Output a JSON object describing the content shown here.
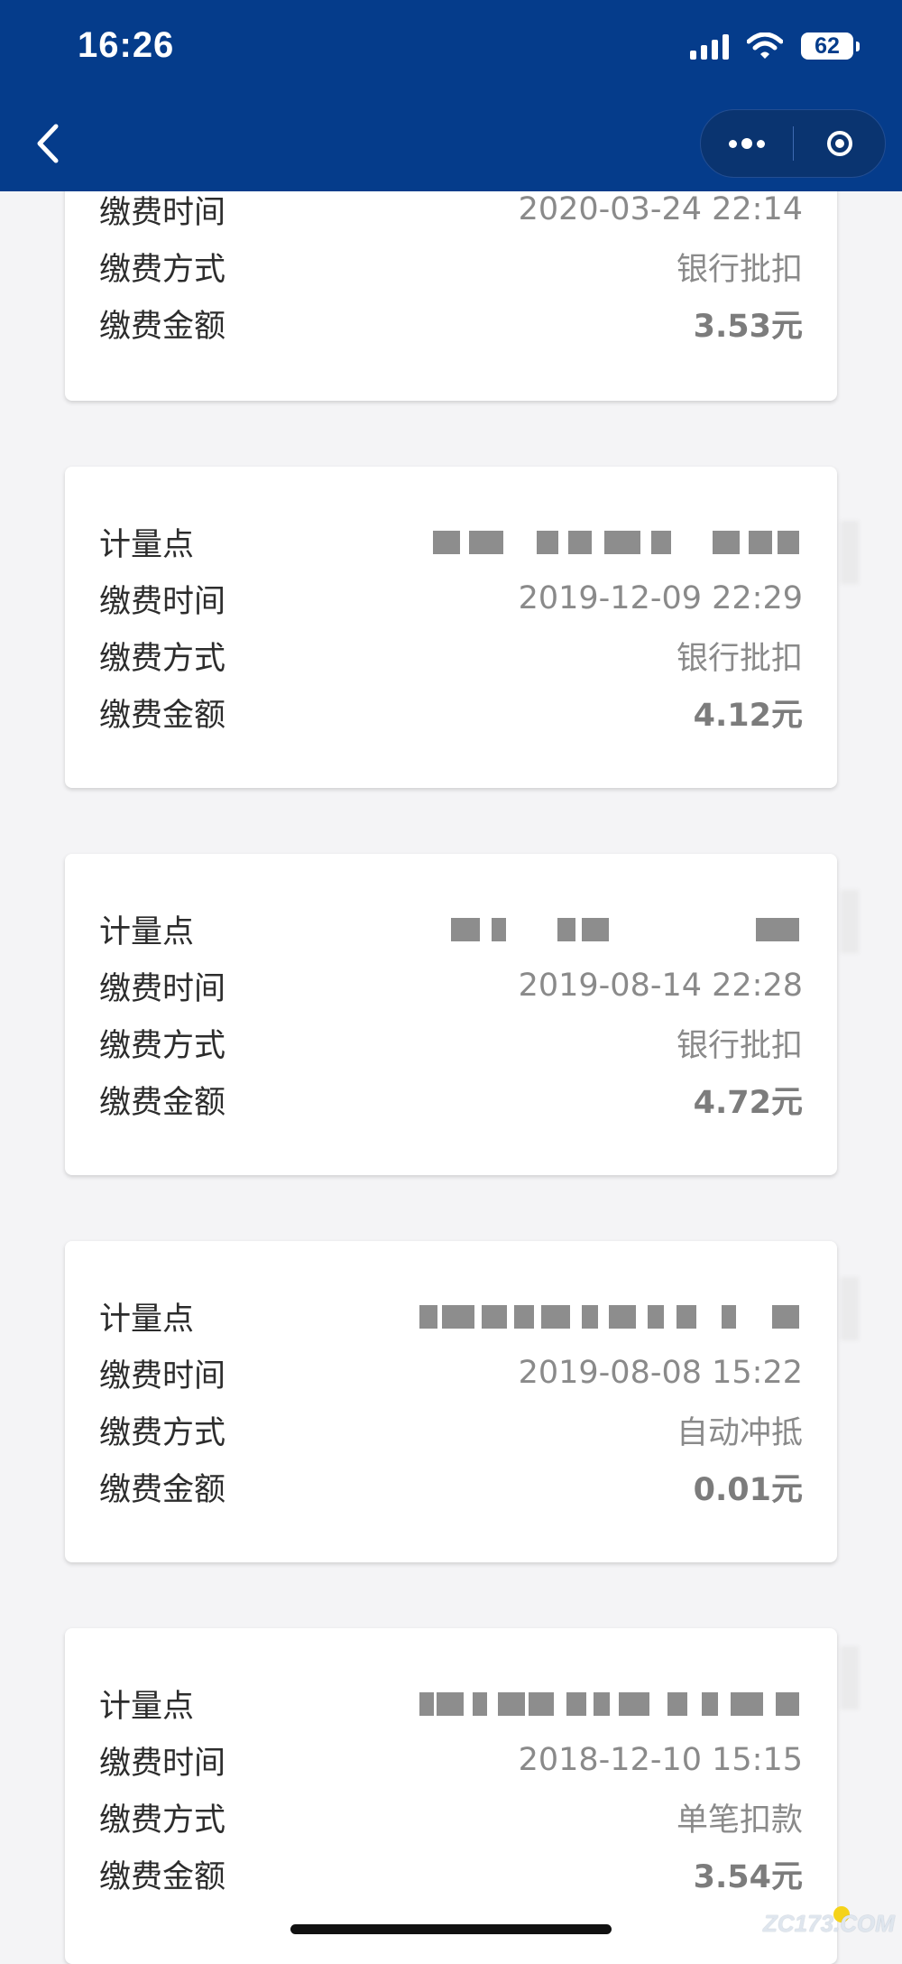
{
  "status_bar": {
    "time": "16:26",
    "battery": "62"
  },
  "field_labels": {
    "meter_point": "计量点",
    "pay_time": "缴费时间",
    "pay_method": "缴费方式",
    "pay_amount": "缴费金额"
  },
  "records": [
    {
      "pay_time": "2020-03-24 22:14",
      "pay_method": "银行批扣",
      "pay_amount": "3.53元"
    },
    {
      "pay_time": "2019-12-09 22:29",
      "pay_method": "银行批扣",
      "pay_amount": "4.12元"
    },
    {
      "pay_time": "2019-08-14 22:28",
      "pay_method": "银行批扣",
      "pay_amount": "4.72元"
    },
    {
      "pay_time": "2019-08-08 15:22",
      "pay_method": "自动冲抵",
      "pay_amount": "0.01元"
    },
    {
      "pay_time": "2018-12-10 15:15",
      "pay_method": "单笔扣款",
      "pay_amount": "3.54元"
    }
  ],
  "watermark": "ZC173.COM"
}
